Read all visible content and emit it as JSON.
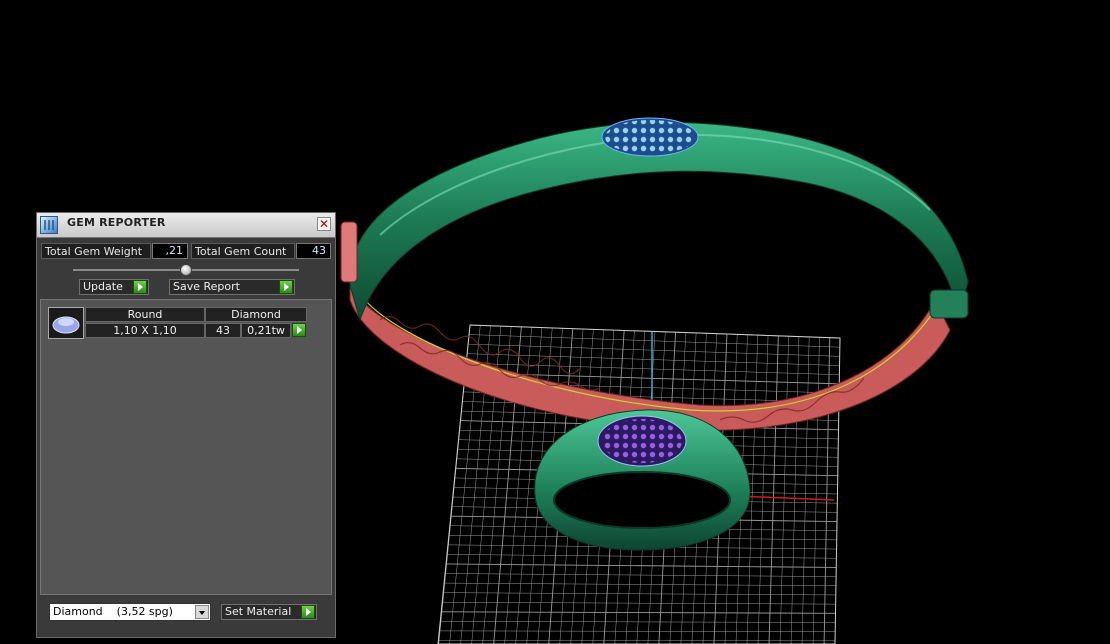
{
  "panel": {
    "title": "GEM REPORTER",
    "close_symbol": "✕",
    "total_weight_label": "Total Gem Weight",
    "total_weight_value": ",21",
    "total_count_label": "Total Gem Count",
    "total_count_value": "43",
    "update_label": "Update",
    "save_report_label": "Save Report",
    "gem_row": {
      "cut": "Round",
      "material": "Diamond",
      "size": "1,10 X 1,10",
      "count": "43",
      "weight": "0,21tw"
    },
    "material_select": "Diamond    (3,52 spg)",
    "set_material_label": "Set Material"
  },
  "colors": {
    "band": "#1c7a55",
    "band_inner": "#c95a5a",
    "gem": "#7fb8e8",
    "gem_inner": "#8a4fc8",
    "grid": "#bdbdbd",
    "accent_green": "#3aa82a"
  },
  "icons": [
    "gem-reporter-icon",
    "close-icon",
    "go-arrow-icon",
    "gem-thumbnail-icon",
    "chevron-down-icon"
  ]
}
